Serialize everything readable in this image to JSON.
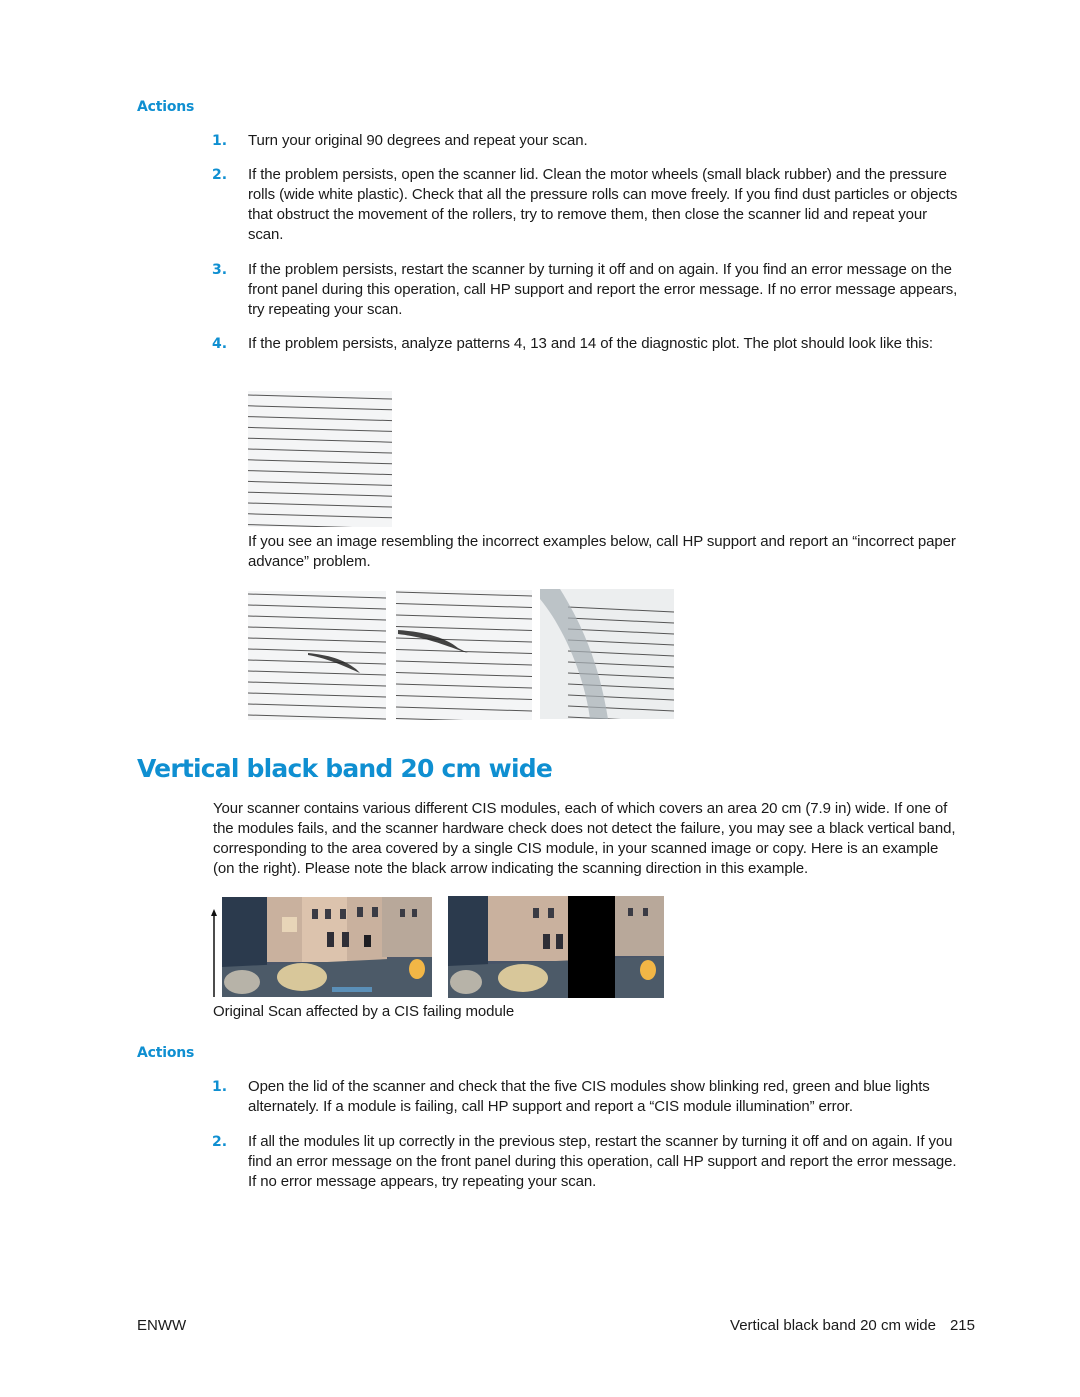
{
  "section1": {
    "actions_heading": "Actions",
    "steps": [
      {
        "num": "1.",
        "text": "Turn your original 90 degrees and repeat your scan."
      },
      {
        "num": "2.",
        "text": "If the problem persists, open the scanner lid. Clean the motor wheels (small black rubber) and the pressure rolls (wide white plastic). Check that all the pressure rolls can move freely. If you find dust particles or objects that obstruct the movement of the rollers, try to remove them, then close the scanner lid and repeat your scan."
      },
      {
        "num": "3.",
        "text": "If the problem persists, restart the scanner by turning it off and on again. If you find an error message on the front panel during this operation, call HP support and report the error message. If no error message appears, try repeating your scan."
      },
      {
        "num": "4.",
        "text": "If the problem persists, analyze patterns 4, 13 and 14 of the diagnostic plot. The plot should look like this:"
      }
    ],
    "correct_image": "diagnostic-plot-correct",
    "incorrect_note": "If you see an image resembling the incorrect examples below, call HP support and report an “incorrect paper advance” problem.",
    "incorrect_images": [
      "diagnostic-plot-incorrect-1",
      "diagnostic-plot-incorrect-2",
      "diagnostic-plot-incorrect-3"
    ]
  },
  "section2": {
    "title": "Vertical black band 20 cm wide",
    "intro": "Your scanner contains various different CIS modules, each of which covers an area 20 cm (7.9 in) wide. If one of the modules fails, and the scanner hardware check does not detect the failure, you may see a black vertical band, corresponding to the area covered by a single CIS module, in your scanned image or copy. Here is an example (on the right). Please note the black arrow indicating the scanning direction in this example.",
    "figure_caption": "Original Scan affected by a CIS failing module",
    "actions_heading": "Actions",
    "steps": [
      {
        "num": "1.",
        "text": "Open the lid of the scanner and check that the five CIS modules show blinking red, green and blue lights alternately. If a module is failing, call HP support and report a “CIS module illumination” error."
      },
      {
        "num": "2.",
        "text": "If all the modules lit up correctly in the previous step, restart the scanner by turning it off and on again. If you find an error message on the front panel during this operation, call HP support and report the error message. If no error message appears, try repeating your scan."
      }
    ]
  },
  "footer": {
    "left": "ENWW",
    "section_title": "Vertical black band 20 cm wide",
    "page_number": "215"
  },
  "colors": {
    "accent": "#0f8fd1",
    "text": "#1a1a1a"
  }
}
